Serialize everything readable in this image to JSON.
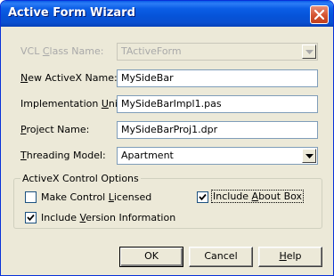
{
  "window": {
    "title": "Active Form Wizard",
    "close_icon": "close-icon"
  },
  "fields": {
    "vcl_class_name": {
      "label_pre": "VCL ",
      "label_key": "C",
      "label_post": "lass Name:",
      "value": "TActiveForm"
    },
    "new_activex_name": {
      "label_key": "N",
      "label_post": "ew ActiveX Name:",
      "value": "MySideBar"
    },
    "implementation_unit": {
      "label_pre": "Implementation ",
      "label_key": "U",
      "label_post": "nit:",
      "value": "MySideBarImpl1.pas"
    },
    "project_name": {
      "label_key": "P",
      "label_post": "roject Name:",
      "value": "MySideBarProj1.dpr"
    },
    "threading_model": {
      "label_key": "T",
      "label_post": "hreading Model:",
      "value": "Apartment"
    }
  },
  "options": {
    "group_title": "ActiveX Control Options",
    "make_control_licensed": {
      "label_pre": "Make Control ",
      "label_key": "L",
      "label_post": "icensed",
      "checked": false
    },
    "include_about_box": {
      "label_pre": "Include ",
      "label_key": "A",
      "label_post": "bout Box",
      "checked": true
    },
    "include_version_information": {
      "label_pre": "Include ",
      "label_key": "V",
      "label_post": "ersion Information",
      "checked": true
    }
  },
  "buttons": {
    "ok": "OK",
    "cancel": "Cancel",
    "help_key": "H",
    "help_post": "elp"
  }
}
